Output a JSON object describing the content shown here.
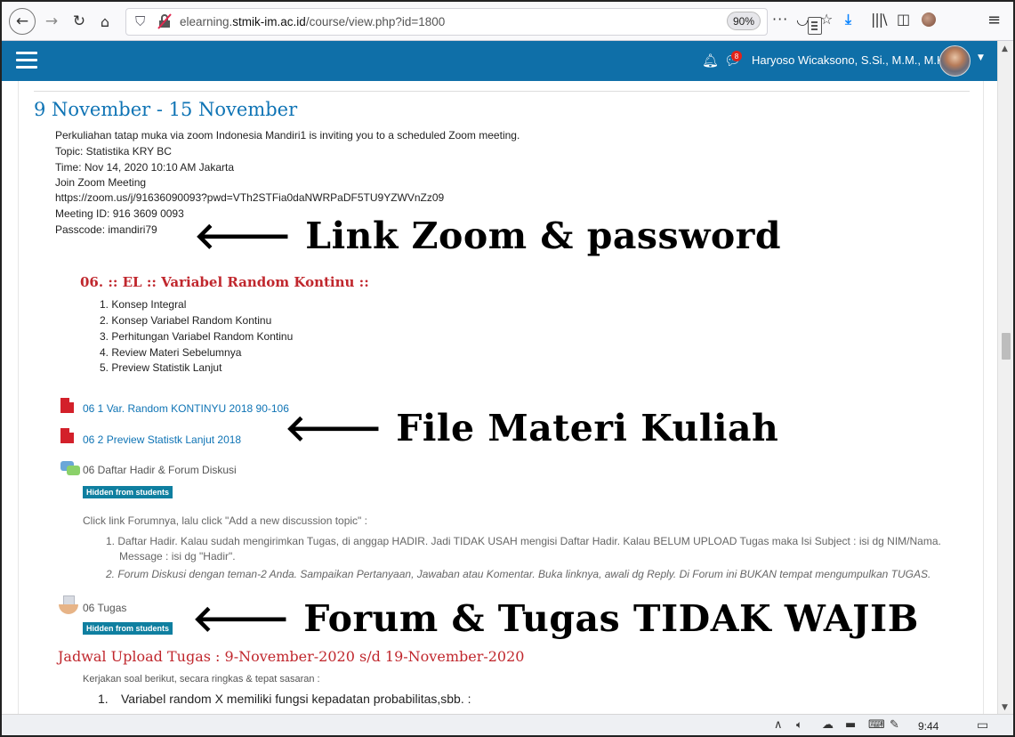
{
  "browser": {
    "url_prefix": "elearning.",
    "url_domain": "stmik-im.ac.id",
    "url_path": "/course/view.php?id=1800",
    "zoom": "90%"
  },
  "navbar": {
    "notif_count": "8",
    "user_name": "Haryoso Wicaksono, S.Si., M.M., M.Kom."
  },
  "section": {
    "title": "9 November - 15 November",
    "zoom_lines": [
      "Perkuliahan tatap muka via zoom Indonesia Mandiri1 is inviting you to a scheduled Zoom meeting.",
      "Topic: Statistika KRY BC",
      "Time: Nov 14, 2020 10:10 AM Jakarta",
      "Join Zoom Meeting",
      "https://zoom.us/j/91636090093?pwd=VTh2STFia0daNWRPaDF5TU9YZWVnZz09",
      "Meeting ID: 916 3609 0093",
      "Passcode: imandiri79"
    ],
    "topic_heading": "06. :: EL :: Variabel Random Kontinu ::",
    "topics": [
      "1. Konsep Integral",
      "2. Konsep Variabel Random Kontinu",
      "3. Perhitungan Variabel Random Kontinu",
      "4. Review Materi Sebelumnya",
      "5. Preview Statistik Lanjut"
    ],
    "resources": [
      "06 1 Var. Random KONTINYU 2018 90-106",
      "06 2 Preview Statistk Lanjut 2018"
    ],
    "forum_label": "06 Daftar Hadir & Forum Diskusi",
    "hidden_badge": "Hidden from students",
    "forum_instruction": "Click link Forumnya, lalu click \"Add a new discussion topic\" :",
    "forum_items": [
      "1. Daftar Hadir. Kalau sudah mengirimkan Tugas, di anggap HADIR. Jadi TIDAK USAH mengisi Daftar Hadir. Kalau BELUM UPLOAD Tugas maka Isi Subject : isi dg NIM/Nama.",
      "Message : isi dg \"Hadir\".",
      "2. Forum Diskusi dengan teman-2 Anda. Sampaikan Pertanyaan, Jawaban atau Komentar. Buka linknya, awali dg Reply. Di Forum ini BUKAN tempat mengumpulkan TUGAS."
    ],
    "assignment_label": "06 Tugas",
    "schedule_heading": "Jadwal Upload Tugas : 9-November-2020 s/d 19-November-2020",
    "task_instruction": "Kerjakan soal berikut, secara ringkas & tepat sasaran :",
    "question_num": "1.",
    "question_text": "Variabel random X memiliki fungsi kepadatan probabilitas,sbb. :"
  },
  "annotations": {
    "zoom_link": "Link Zoom & password",
    "materials": "File Materi Kuliah",
    "forum_task": "Forum & Tugas TIDAK WAJIB"
  },
  "taskbar": {
    "clock": "9:44"
  },
  "colors": {
    "nav_blue": "#0f6fa8",
    "link_blue": "#0f74b5",
    "heading_red": "#c0272d",
    "badge_teal": "#0f7fa0"
  }
}
